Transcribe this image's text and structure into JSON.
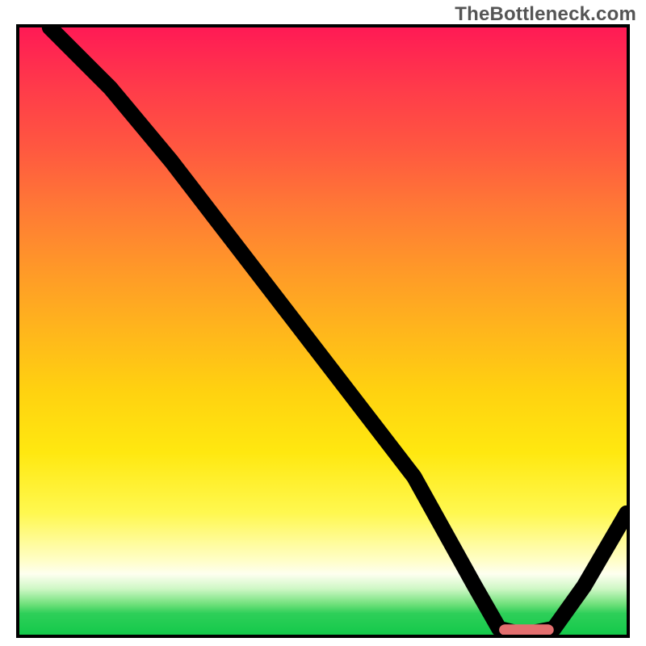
{
  "watermark": "TheBottleneck.com",
  "chart_data": {
    "type": "line",
    "title": "",
    "xlabel": "",
    "ylabel": "",
    "xlim": [
      0,
      100
    ],
    "ylim": [
      0,
      100
    ],
    "grid": false,
    "legend": false,
    "series": [
      {
        "name": "bottleneck-curve",
        "x": [
          5,
          15,
          25,
          35,
          45,
          55,
          65,
          75,
          79,
          83,
          88,
          93,
          100
        ],
        "y": [
          100,
          90,
          78,
          65,
          52,
          39,
          26,
          8,
          1,
          0,
          1,
          8,
          20
        ]
      }
    ],
    "marker": {
      "name": "optimal-range",
      "x_start": 79,
      "x_end": 88,
      "y": 0.5,
      "color": "#e36f6f"
    },
    "background_gradient": {
      "direction": "vertical",
      "stops": [
        {
          "pos": 0,
          "color": "#ff1a55"
        },
        {
          "pos": 0.3,
          "color": "#ff7a35"
        },
        {
          "pos": 0.6,
          "color": "#ffd210"
        },
        {
          "pos": 0.88,
          "color": "#fffecb"
        },
        {
          "pos": 0.96,
          "color": "#2ecf59"
        },
        {
          "pos": 1.0,
          "color": "#14c94a"
        }
      ]
    }
  }
}
